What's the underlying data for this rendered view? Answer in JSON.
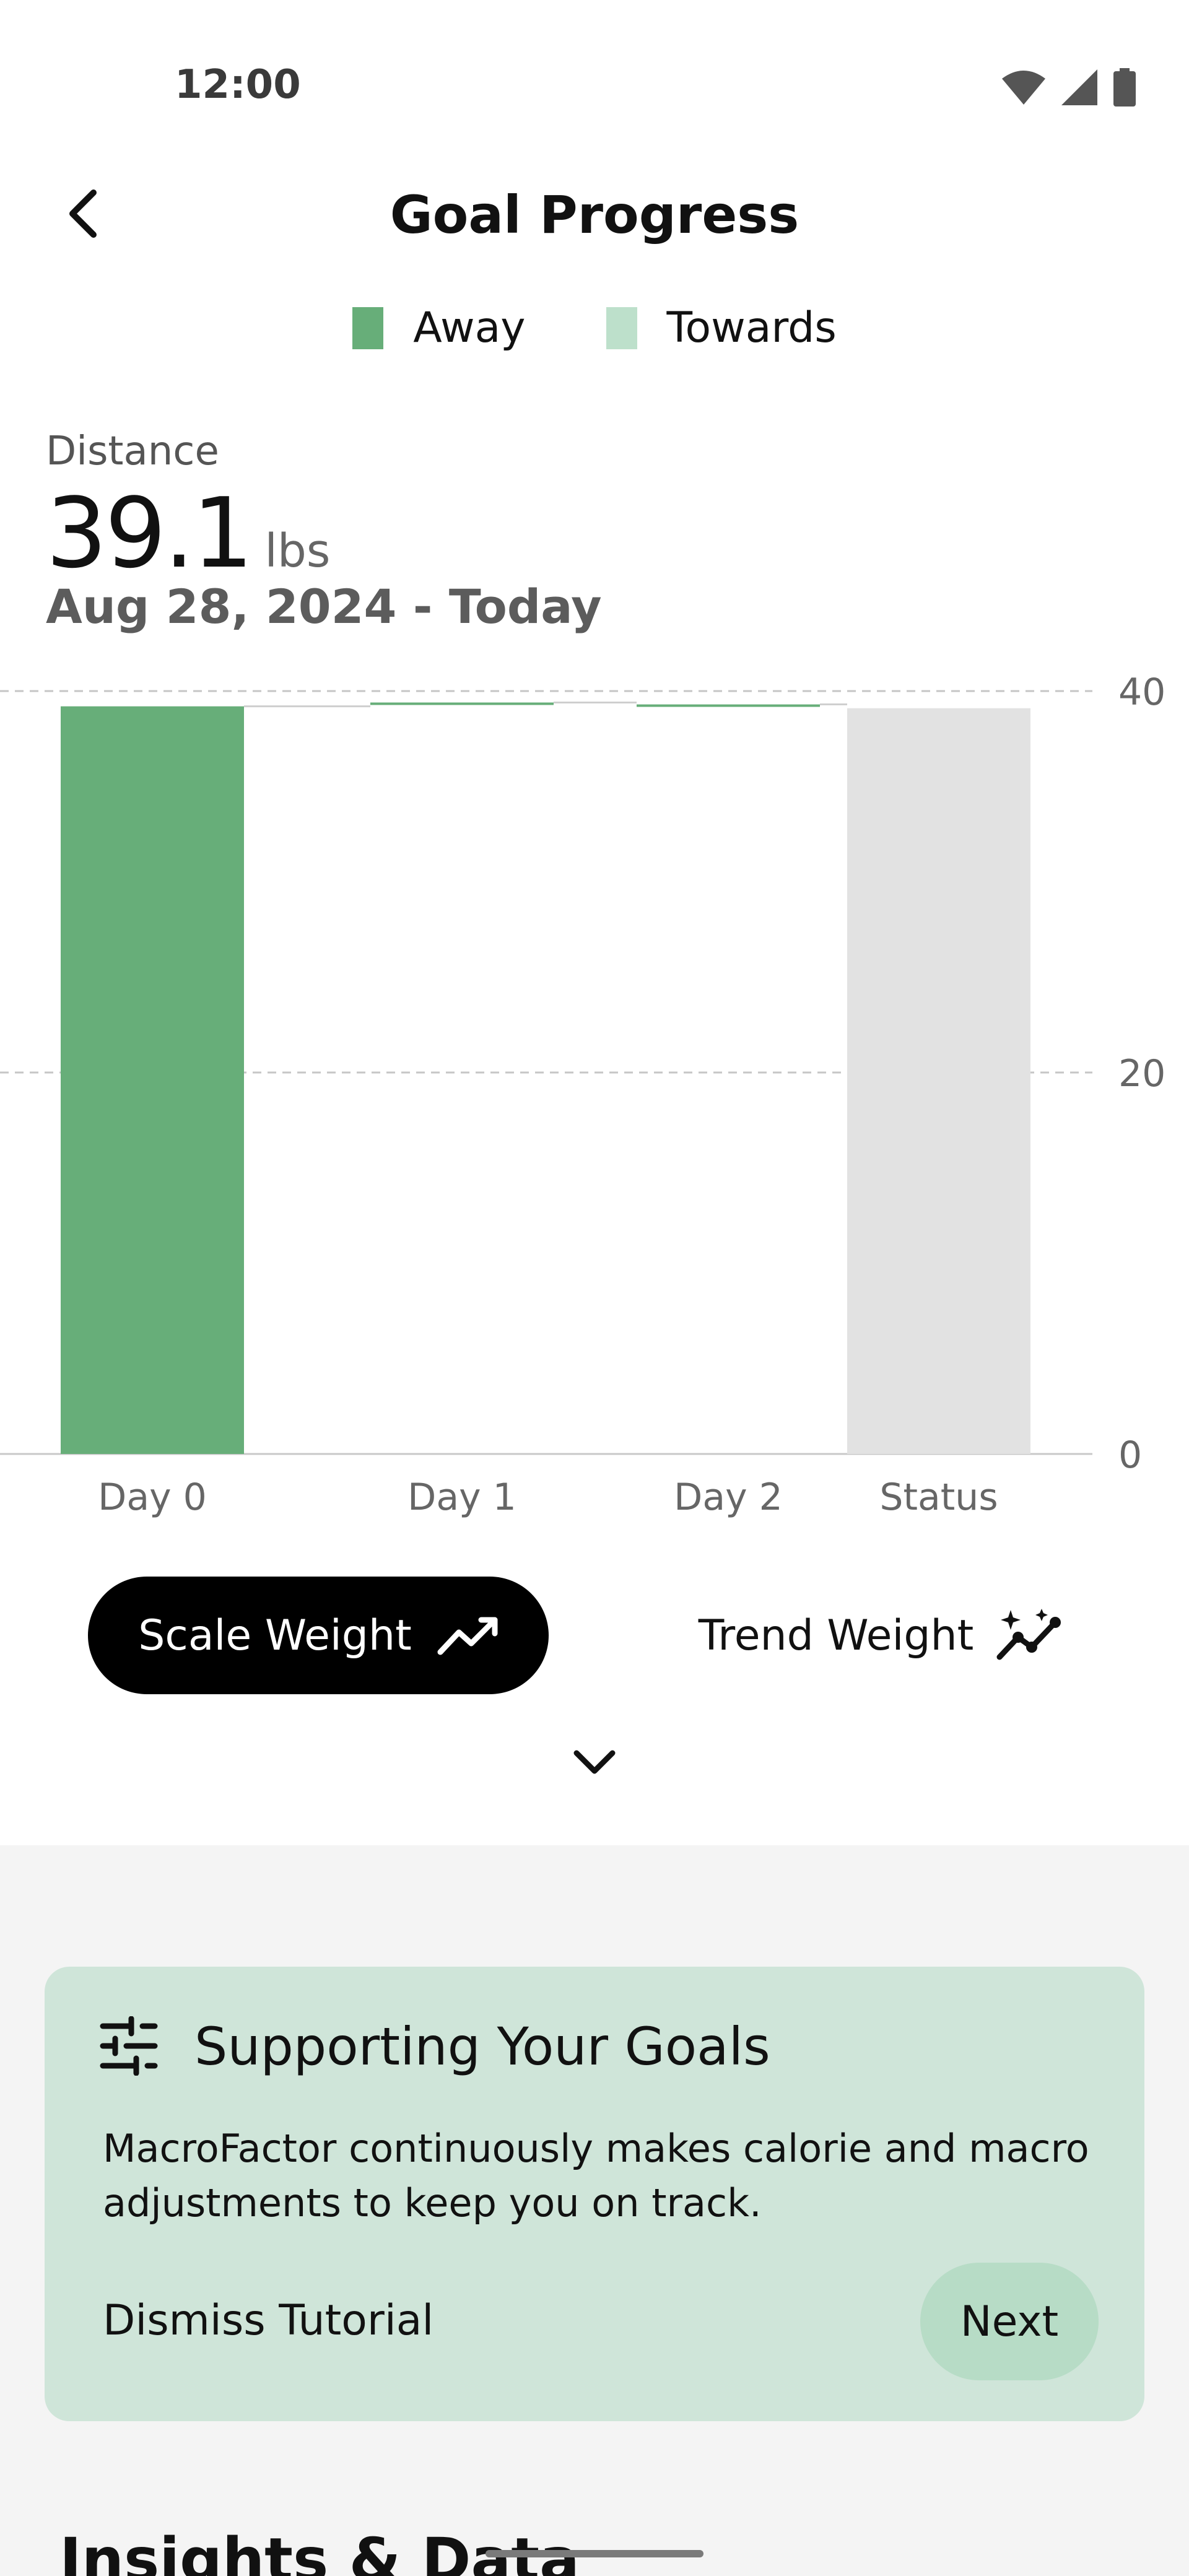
{
  "status_bar": {
    "time": "12:00"
  },
  "header": {
    "title": "Goal Progress"
  },
  "legend": [
    {
      "label": "Away",
      "color": "#67ae79"
    },
    {
      "label": "Towards",
      "color": "#bde0cb"
    }
  ],
  "summary": {
    "label": "Distance",
    "value": "39.1",
    "unit": "lbs",
    "date_range": "Aug 28, 2024 - Today"
  },
  "chart_data": {
    "type": "bar",
    "categories": [
      "Day 0",
      "Day 1",
      "Day 2",
      "Status"
    ],
    "ylim": [
      0,
      40
    ],
    "yticks": [
      "40",
      "20",
      "0"
    ],
    "grid": true,
    "bars": [
      {
        "category": "Day 0",
        "bottom": 0,
        "top": 39.2,
        "kind": "away",
        "color": "#67ae79"
      },
      {
        "category": "Day 1",
        "bottom": 39.3,
        "top": 39.4,
        "kind": "away",
        "color": "#67ae79"
      },
      {
        "category": "Day 2",
        "bottom": 39.2,
        "top": 39.3,
        "kind": "away",
        "color": "#67ae79"
      },
      {
        "category": "Status",
        "bottom": 0,
        "top": 39.1,
        "kind": "status",
        "color": "#e2e2e2"
      }
    ]
  },
  "weight_toggle": {
    "scale_label": "Scale Weight",
    "trend_label": "Trend Weight",
    "selected": "Scale Weight"
  },
  "tutorial": {
    "title": "Supporting Your Goals",
    "body": "MacroFactor continuously makes calorie and macro adjustments to keep you on track.",
    "dismiss_label": "Dismiss Tutorial",
    "next_label": "Next"
  },
  "section": {
    "heading": "Insights & Data"
  },
  "icons": {
    "back": "chevron-left-icon",
    "scale": "trend-line-icon",
    "trend": "sparkle-trend-icon",
    "expand": "chevron-down-icon",
    "card": "sliders-icon"
  }
}
